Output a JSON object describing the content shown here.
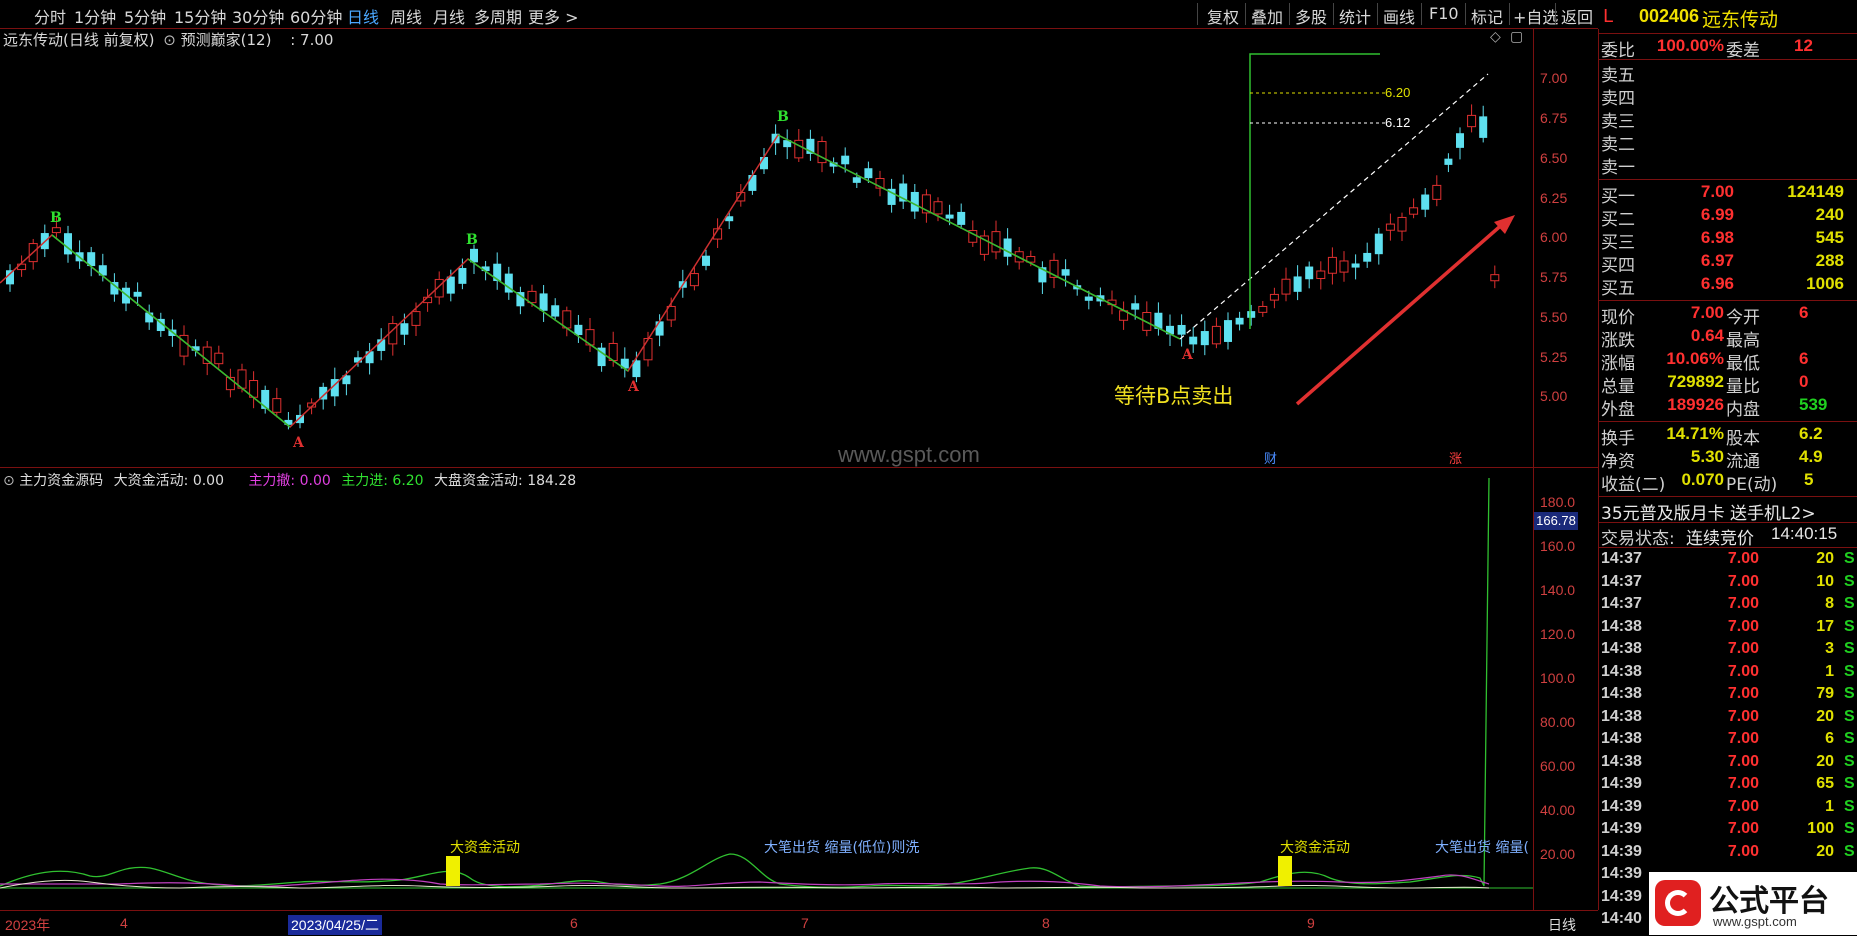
{
  "toolbar": {
    "left_items": [
      "分时",
      "1分钟",
      "5分钟",
      "15分钟",
      "30分钟",
      "60分钟",
      "日线",
      "周线",
      "月线",
      "多周期",
      "更多 >"
    ],
    "active": "日线",
    "right_items": [
      "复权",
      "叠加",
      "多股",
      "统计",
      "画线",
      "F10",
      "标记",
      "+自选",
      "返回"
    ]
  },
  "chart": {
    "title": "远东传动(日线 前复权)",
    "indicator": "预测巅家(12)",
    "indicator_value": ": 7.00",
    "annotation": "等待B点卖出",
    "watermark": "www.gspt.com",
    "wave_labels": [
      "B",
      "A",
      "B",
      "A",
      "B",
      "A"
    ],
    "event_markers": [
      "财",
      "涨"
    ],
    "target_lines": [
      "6.20",
      "6.12"
    ],
    "price_ticks": [
      "7.00",
      "6.75",
      "6.50",
      "6.25",
      "6.00",
      "5.75",
      "5.50",
      "5.25",
      "5.00"
    ]
  },
  "lower": {
    "title": "主力资金源码",
    "big_label": "大资金活动:",
    "big_value": "0.00",
    "out_label": "主力撤:",
    "out_value": "0.00",
    "in_label": "主力进:",
    "in_value": "6.20",
    "market_label": "大盘资金活动:",
    "market_value": "184.28",
    "y_ticks": [
      "180.0",
      "160.0",
      "140.0",
      "120.0",
      "100.0",
      "80.00",
      "60.00",
      "40.00",
      "20.00"
    ],
    "current_marker": "166.78",
    "notes": [
      "大资金活动",
      "大笔出货 缩量(低位)则洗",
      "大资金活动",
      "大笔出货 缩量("
    ]
  },
  "xaxis": {
    "labels": [
      "2023年",
      "4",
      "2023/04/25/二",
      "6",
      "7",
      "8",
      "9"
    ],
    "period": "日线"
  },
  "quote": {
    "flag": "L",
    "code": "002406",
    "name": "远东传动",
    "weibi_label": "委比",
    "weibi_value": "100.00%",
    "weicha_label": "委差",
    "weicha_value": "12",
    "asks": [
      {
        "label": "卖五"
      },
      {
        "label": "卖四"
      },
      {
        "label": "卖三"
      },
      {
        "label": "卖二"
      },
      {
        "label": "卖一"
      }
    ],
    "bids": [
      {
        "label": "买一",
        "price": "7.00",
        "vol": "124149"
      },
      {
        "label": "买二",
        "price": "6.99",
        "vol": "240"
      },
      {
        "label": "买三",
        "price": "6.98",
        "vol": "545"
      },
      {
        "label": "买四",
        "price": "6.97",
        "vol": "288"
      },
      {
        "label": "买五",
        "price": "6.96",
        "vol": "1006"
      }
    ],
    "stats": [
      {
        "l1": "现价",
        "v1": "7.00",
        "l2": "今开",
        "v2": "6"
      },
      {
        "l1": "涨跌",
        "v1": "0.64",
        "l2": "最高",
        "v2": ""
      },
      {
        "l1": "涨幅",
        "v1": "10.06%",
        "l2": "最低",
        "v2": "6"
      },
      {
        "l1": "总量",
        "v1": "729892",
        "l2": "量比",
        "v2": "0"
      },
      {
        "l1": "外盘",
        "v1": "189926",
        "l2": "内盘",
        "v2": "539"
      }
    ],
    "stats2": [
      {
        "l1": "换手",
        "v1": "14.71%",
        "l2": "股本",
        "v2": "6.2"
      },
      {
        "l1": "净资",
        "v1": "5.30",
        "l2": "流通",
        "v2": "4.9"
      },
      {
        "l1": "收益(二)",
        "v1": "0.070",
        "l2": "PE(动)",
        "v2": "5"
      }
    ],
    "promo": "35元普及版月卡 送手机L2>",
    "trade_state_label": "交易状态:",
    "trade_state": "连续竞价",
    "trade_time": "14:40:15",
    "ticks": [
      {
        "t": "14:37",
        "p": "7.00",
        "v": "20",
        "s": "S"
      },
      {
        "t": "14:37",
        "p": "7.00",
        "v": "10",
        "s": "S"
      },
      {
        "t": "14:37",
        "p": "7.00",
        "v": "8",
        "s": "S"
      },
      {
        "t": "14:38",
        "p": "7.00",
        "v": "17",
        "s": "S"
      },
      {
        "t": "14:38",
        "p": "7.00",
        "v": "3",
        "s": "S"
      },
      {
        "t": "14:38",
        "p": "7.00",
        "v": "1",
        "s": "S"
      },
      {
        "t": "14:38",
        "p": "7.00",
        "v": "79",
        "s": "S"
      },
      {
        "t": "14:38",
        "p": "7.00",
        "v": "20",
        "s": "S"
      },
      {
        "t": "14:38",
        "p": "7.00",
        "v": "6",
        "s": "S"
      },
      {
        "t": "14:38",
        "p": "7.00",
        "v": "20",
        "s": "S"
      },
      {
        "t": "14:39",
        "p": "7.00",
        "v": "65",
        "s": "S"
      },
      {
        "t": "14:39",
        "p": "7.00",
        "v": "1",
        "s": "S"
      },
      {
        "t": "14:39",
        "p": "7.00",
        "v": "100",
        "s": "S"
      },
      {
        "t": "14:39",
        "p": "7.00",
        "v": "20",
        "s": "S"
      },
      {
        "t": "14:39",
        "p": "",
        "v": "",
        "s": ""
      },
      {
        "t": "14:39",
        "p": "",
        "v": "",
        "s": ""
      },
      {
        "t": "14:40",
        "p": "",
        "v": "",
        "s": ""
      }
    ]
  },
  "logo": {
    "text": "公式平台",
    "url": "www.gspt.com"
  }
}
